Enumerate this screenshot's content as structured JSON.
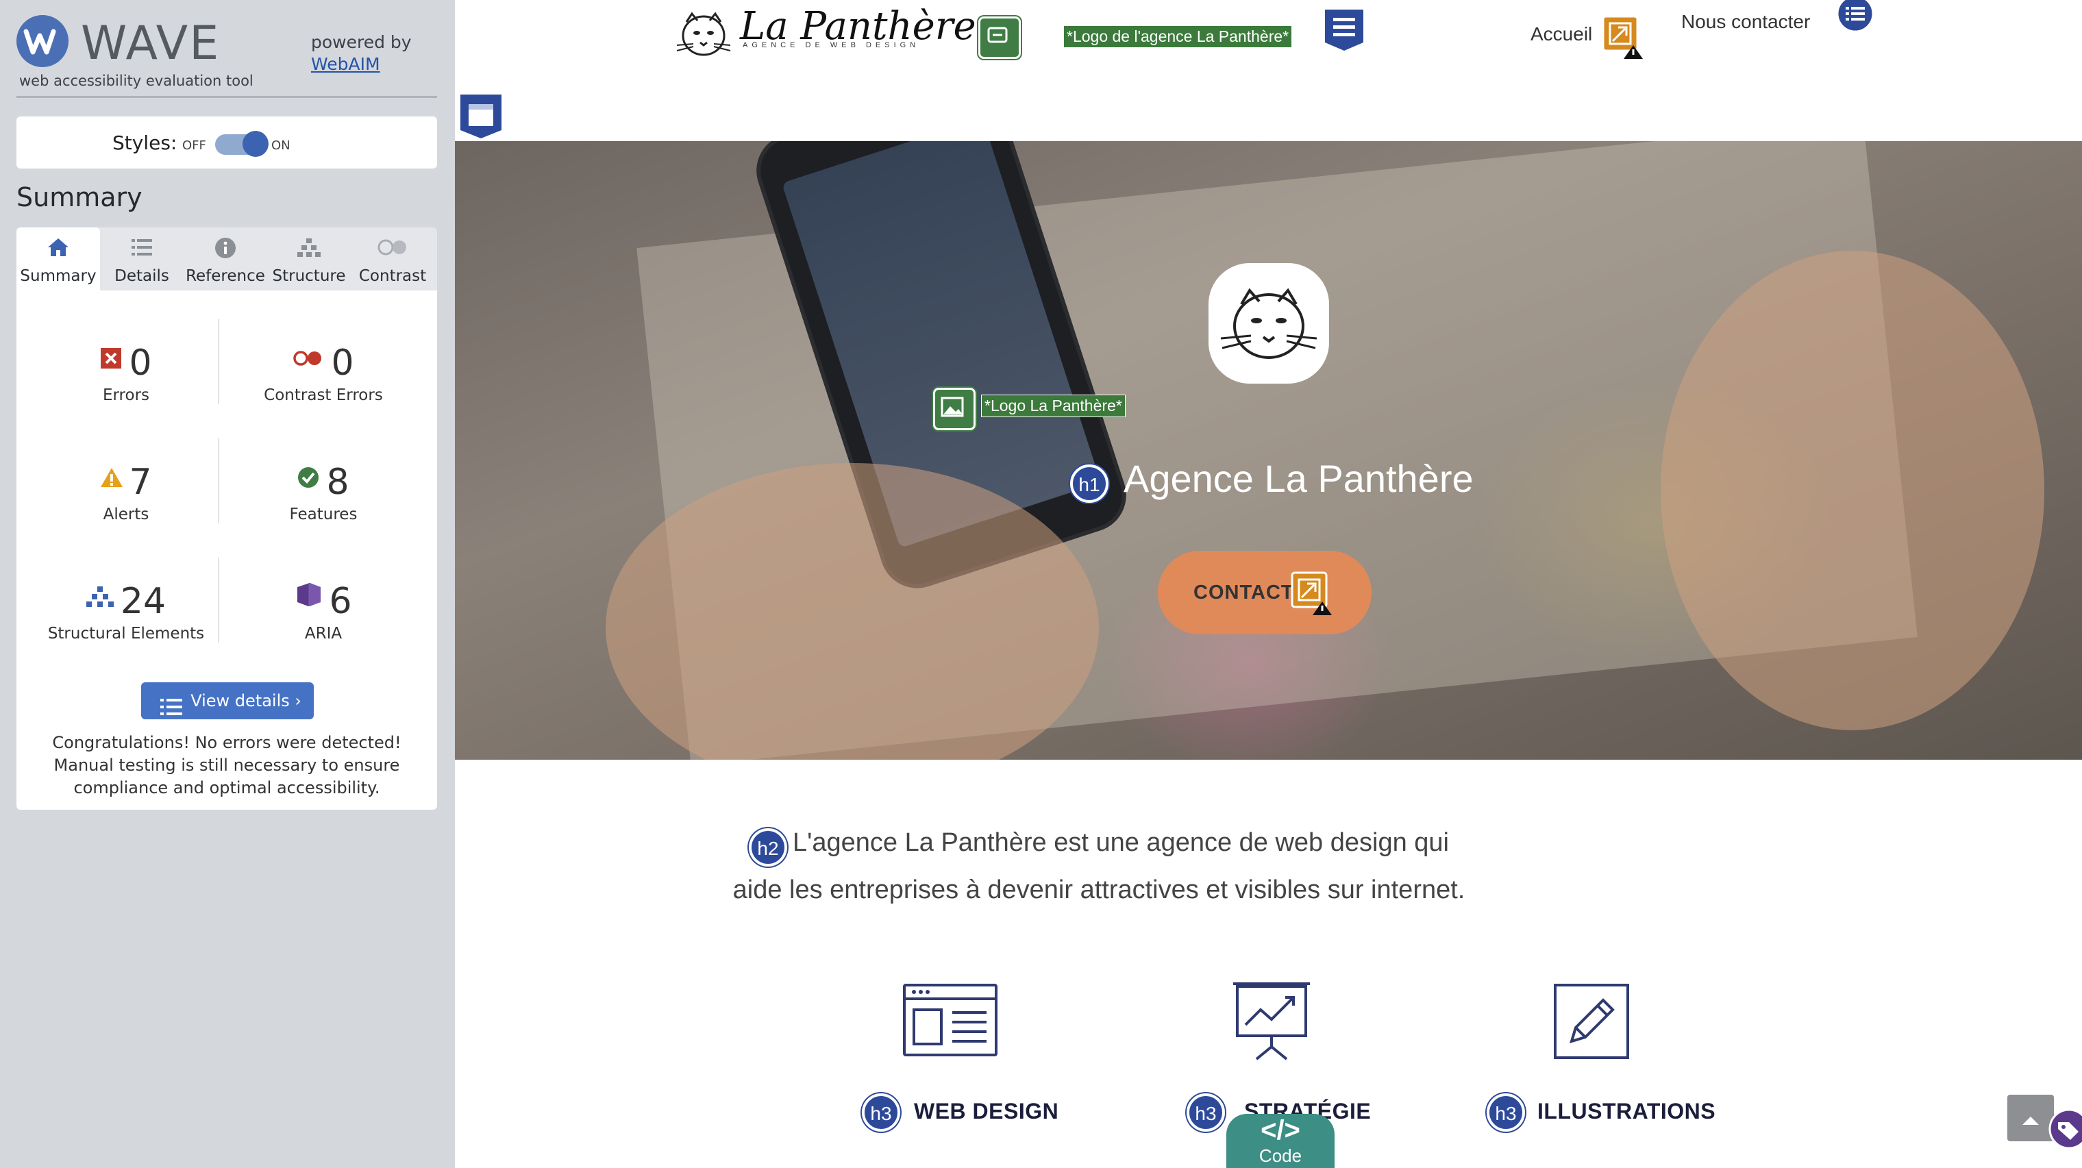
{
  "wave": {
    "title": "WAVE",
    "tagline": "web accessibility evaluation tool",
    "powered_by": "powered by",
    "webaim_link": "WebAIM",
    "styles_label": "Styles:",
    "toggle_off": "OFF",
    "toggle_on": "ON",
    "summary_heading": "Summary",
    "tabs": [
      {
        "label": "Summary",
        "icon": "home-icon",
        "active": true
      },
      {
        "label": "Details",
        "icon": "list-icon",
        "active": false
      },
      {
        "label": "Reference",
        "icon": "info-icon",
        "active": false
      },
      {
        "label": "Structure",
        "icon": "structure-icon",
        "active": false
      },
      {
        "label": "Contrast",
        "icon": "contrast-icon",
        "active": false
      }
    ],
    "stats": {
      "errors": {
        "value": "0",
        "label": "Errors",
        "color": "#c0392b"
      },
      "contrast_errors": {
        "value": "0",
        "label": "Contrast Errors",
        "color": "#c0392b"
      },
      "alerts": {
        "value": "7",
        "label": "Alerts",
        "color": "#e6a11a"
      },
      "features": {
        "value": "8",
        "label": "Features",
        "color": "#3f7d44"
      },
      "structural": {
        "value": "24",
        "label": "Structural Elements",
        "color": "#3c63b2"
      },
      "aria": {
        "value": "6",
        "label": "ARIA",
        "color": "#5b3a8c"
      }
    },
    "view_details": "View details ›",
    "congrats": "Congratulations! No errors were detected! Manual testing is still necessary to ensure compliance and optimal accessibility."
  },
  "site": {
    "brand": "La Panthère",
    "brand_sub": "AGENCE DE WEB DESIGN",
    "logo_alt_label": "*Logo de l'agence La Panthère*",
    "nav": {
      "home": "Accueil",
      "contact": "Nous contacter"
    },
    "hero_logo_alt": "*Logo La Panthère*",
    "hero_title": "Agence La Panthère",
    "contact_button": "CONTACT",
    "intro_line1": "L'agence La Panthère est une agence de web design qui",
    "intro_line2": "aide les entreprises à devenir attractives et visibles sur internet.",
    "services": [
      {
        "title": "WEB DESIGN",
        "icon": "browser-layout-icon"
      },
      {
        "title": "STRATÉGIE",
        "icon": "presentation-chart-icon"
      },
      {
        "title": "ILLUSTRATIONS",
        "icon": "pencil-icon"
      }
    ],
    "heading_badges": {
      "h1": "h1",
      "h2": "h2",
      "h3": "h3"
    },
    "code_tab": "Code",
    "colors": {
      "wave_blue": "#3c63b2",
      "contact_orange": "#e08a5a",
      "alt_green": "#3f7d44",
      "heading_navy": "#1b1d3a"
    }
  }
}
